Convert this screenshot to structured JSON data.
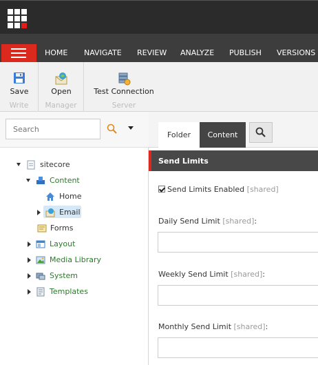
{
  "menu_tabs": [
    "HOME",
    "NAVIGATE",
    "REVIEW",
    "ANALYZE",
    "PUBLISH",
    "VERSIONS"
  ],
  "ribbon": {
    "groups": [
      {
        "buttons": [
          {
            "label": "Save"
          }
        ],
        "name": "Write"
      },
      {
        "buttons": [
          {
            "label": "Open"
          }
        ],
        "name": "Manager"
      },
      {
        "buttons": [
          {
            "label": "Test Connection"
          }
        ],
        "name": "Server"
      }
    ]
  },
  "search": {
    "placeholder": "Search"
  },
  "tree": [
    {
      "label": "sitecore"
    },
    {
      "label": "Content"
    },
    {
      "label": "Home"
    },
    {
      "label": "Email"
    },
    {
      "label": "Forms"
    },
    {
      "label": "Layout"
    },
    {
      "label": "Media Library"
    },
    {
      "label": "System"
    },
    {
      "label": "Templates"
    }
  ],
  "editor_tabs": {
    "folder": "Folder",
    "content": "Content"
  },
  "section": {
    "title": "Send Limits",
    "checkbox": {
      "label": "Send Limits Enabled",
      "suffix": "[shared]",
      "checked": true
    },
    "fields": [
      {
        "label": "Daily Send Limit",
        "suffix": "[shared]",
        "value": ""
      },
      {
        "label": "Weekly Send Limit",
        "suffix": "[shared]",
        "value": ""
      },
      {
        "label": "Monthly Send Limit",
        "suffix": "[shared]",
        "value": ""
      }
    ]
  },
  "colors": {
    "accent": "#dc291e",
    "topbar": "#2b2b2b",
    "ribbon_tabs": "#3d3d3d",
    "tree_green": "#2b7a2b"
  }
}
